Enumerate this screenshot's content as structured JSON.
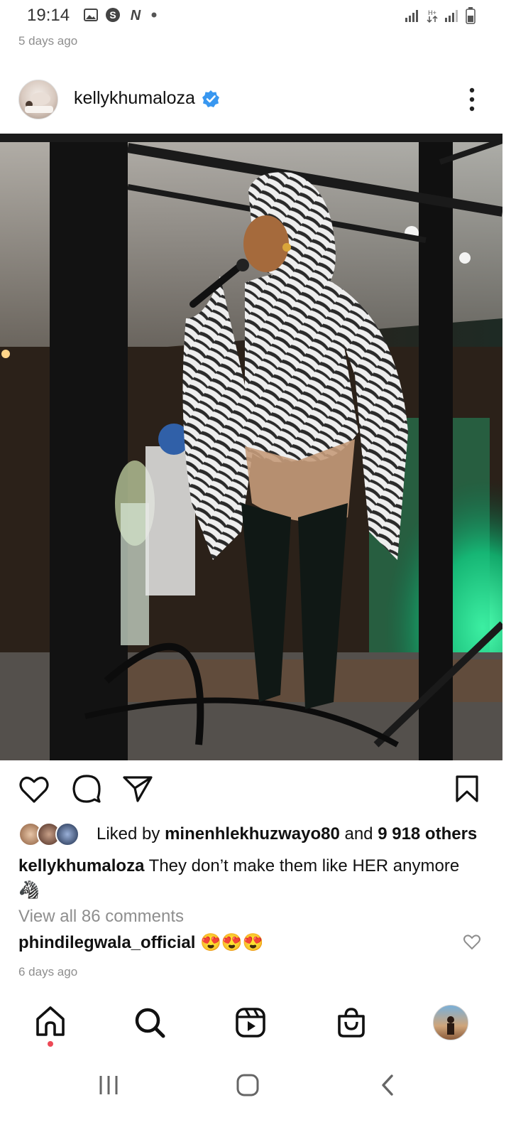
{
  "status_bar": {
    "time": "19:14",
    "left_icons": [
      "gallery-icon",
      "s-app-icon",
      "netflix-icon",
      "dot-icon"
    ],
    "right_icons": [
      "signal-icon",
      "data-icon",
      "signal-icon-2",
      "battery-icon"
    ]
  },
  "previous_post": {
    "timestamp": "5 days ago"
  },
  "post": {
    "username": "kellykhumaloza",
    "verified": true,
    "image_alt": "Woman in zebra print bodysuit singing into microphone on stage",
    "actions": [
      "heart-icon",
      "comment-icon",
      "share-icon",
      "bookmark-icon"
    ],
    "likes": {
      "prefix": "Liked by ",
      "user": "minenhlekhuzwayo80",
      "middle": " and ",
      "others": "9 918 others"
    },
    "caption": {
      "username": "kellykhumaloza",
      "text": "They don’t make them like HER anymore",
      "emoji": "🦓"
    },
    "view_all": "View all 86 comments",
    "top_comment": {
      "username": "phindilegwala_official",
      "text": "😍😍😍"
    },
    "timestamp": "6 days ago"
  },
  "bottom_nav": [
    "home-icon",
    "search-icon",
    "reels-icon",
    "shop-icon",
    "profile-avatar"
  ],
  "colors": {
    "verified": "#3897f0",
    "notification_dot": "#ed4956",
    "muted": "#8e8e8e"
  }
}
